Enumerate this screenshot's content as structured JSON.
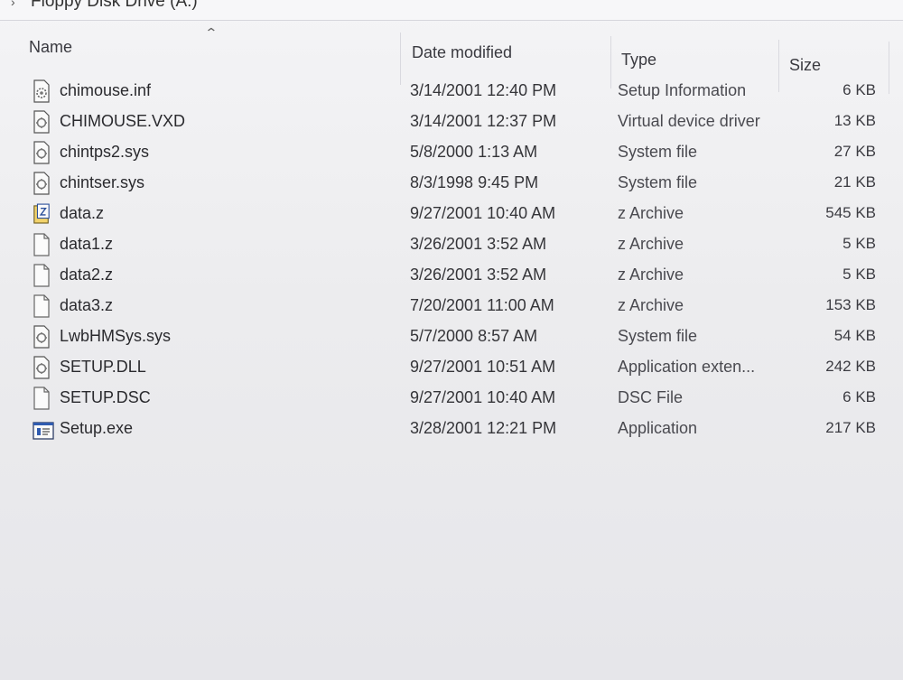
{
  "breadcrumb": {
    "location": "Floppy Disk Drive (A:)"
  },
  "columns": {
    "name": "Name",
    "date": "Date modified",
    "type": "Type",
    "size": "Size"
  },
  "files": [
    {
      "name": "chimouse.inf",
      "date": "3/14/2001 12:40 PM",
      "type": "Setup Information",
      "size": "6 KB",
      "icon": "setup-info-icon"
    },
    {
      "name": "CHIMOUSE.VXD",
      "date": "3/14/2001 12:37 PM",
      "type": "Virtual device driver",
      "size": "13 KB",
      "icon": "system-file-icon"
    },
    {
      "name": "chintps2.sys",
      "date": "5/8/2000 1:13 AM",
      "type": "System file",
      "size": "27 KB",
      "icon": "system-file-icon"
    },
    {
      "name": "chintser.sys",
      "date": "8/3/1998 9:45 PM",
      "type": "System file",
      "size": "21 KB",
      "icon": "system-file-icon"
    },
    {
      "name": "data.z",
      "date": "9/27/2001 10:40 AM",
      "type": "z Archive",
      "size": "545 KB",
      "icon": "archive-icon"
    },
    {
      "name": "data1.z",
      "date": "3/26/2001 3:52 AM",
      "type": "z Archive",
      "size": "5 KB",
      "icon": "blank-file-icon"
    },
    {
      "name": "data2.z",
      "date": "3/26/2001 3:52 AM",
      "type": "z Archive",
      "size": "5 KB",
      "icon": "blank-file-icon"
    },
    {
      "name": "data3.z",
      "date": "7/20/2001 11:00 AM",
      "type": "z Archive",
      "size": "153 KB",
      "icon": "blank-file-icon"
    },
    {
      "name": "LwbHMSys.sys",
      "date": "5/7/2000 8:57 AM",
      "type": "System file",
      "size": "54 KB",
      "icon": "system-file-icon"
    },
    {
      "name": "SETUP.DLL",
      "date": "9/27/2001 10:51 AM",
      "type": "Application exten...",
      "size": "242 KB",
      "icon": "system-file-icon"
    },
    {
      "name": "SETUP.DSC",
      "date": "9/27/2001 10:40 AM",
      "type": "DSC File",
      "size": "6 KB",
      "icon": "blank-file-icon"
    },
    {
      "name": "Setup.exe",
      "date": "3/28/2001 12:21 PM",
      "type": "Application",
      "size": "217 KB",
      "icon": "application-icon"
    }
  ]
}
